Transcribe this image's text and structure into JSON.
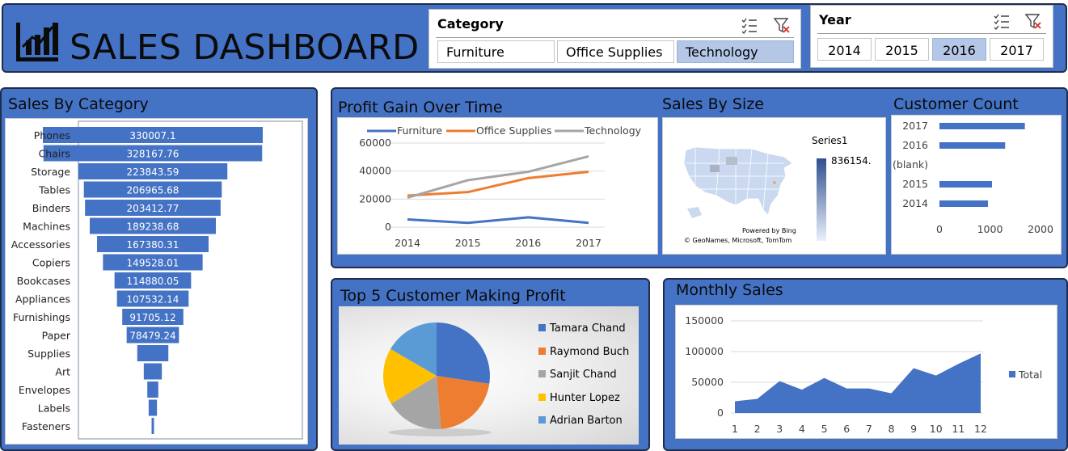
{
  "header": {
    "title": "SALES DASHBOARD"
  },
  "category_slicer": {
    "title": "Category",
    "options": [
      "Furniture",
      "Office Supplies",
      "Technology"
    ],
    "selected": "Technology"
  },
  "year_slicer": {
    "title": "Year",
    "options": [
      "2014",
      "2015",
      "2016",
      "2017"
    ],
    "selected": "2016"
  },
  "colors": {
    "panel": "#4472c4",
    "bar": "#4472c4",
    "furniture": "#4472c4",
    "office": "#ed7d31",
    "tech": "#a5a5a5",
    "selected": "#b4c7e7"
  },
  "chart_data": [
    {
      "type": "bar",
      "title": "Sales By Category",
      "categories": [
        "Phones",
        "Chairs",
        "Storage",
        "Tables",
        "Binders",
        "Machines",
        "Accessories",
        "Copiers",
        "Bookcases",
        "Appliances",
        "Furnishings",
        "Paper",
        "Supplies",
        "Art",
        "Envelopes",
        "Labels",
        "Fasteners"
      ],
      "values": [
        330007.1,
        328167.76,
        223843.59,
        206965.68,
        203412.77,
        189238.68,
        167380.31,
        149528.01,
        114880.05,
        107532.14,
        91705.12,
        78479.24,
        46673.54,
        27118.79,
        16476.4,
        12486.31,
        3024.28
      ],
      "labels": [
        "330007.1",
        "328167.76",
        "223843.59",
        "206965.68",
        "203412.77",
        "189238.68",
        "167380.31",
        "149528.01",
        "114880.05",
        "107532.14",
        "91705.12",
        "78479.24",
        "",
        "",
        "",
        "",
        ""
      ],
      "orientation": "horizontal-funnel"
    },
    {
      "type": "line",
      "title": "Profit Gain Over Time",
      "categories": [
        "2014",
        "2015",
        "2016",
        "2017"
      ],
      "series": [
        {
          "name": "Furniture",
          "values": [
            5500,
            3000,
            7000,
            3000
          ]
        },
        {
          "name": "Office Supplies",
          "values": [
            22500,
            25000,
            35000,
            39500
          ]
        },
        {
          "name": "Technology",
          "values": [
            21000,
            33500,
            39500,
            50500
          ]
        }
      ],
      "yticks": [
        "0",
        "20000",
        "40000",
        "60000"
      ],
      "ylim": [
        0,
        60000
      ],
      "legend": "top",
      "grid": true
    },
    {
      "type": "other",
      "title": "Sales By Size",
      "series_name": "Series1",
      "max_label": "836154.",
      "attribution_1": "Powered by Bing",
      "attribution_2": "© GeoNames, Microsoft, TomTom"
    },
    {
      "type": "bar",
      "title": "Customer Count",
      "categories": [
        "2017",
        "2016",
        "(blank)",
        "2015",
        "2014"
      ],
      "values": [
        1690,
        1300,
        0,
        1040,
        960
      ],
      "xticks": [
        "0",
        "1000",
        "2000"
      ],
      "xlim": [
        0,
        2000
      ],
      "orientation": "horizontal"
    },
    {
      "type": "pie",
      "title": "Top 5 Customer Making Profit",
      "labels": [
        "Tamara Chand",
        "Raymond Buch",
        "Sanjit Chand",
        "Hunter Lopez",
        "Adrian Barton"
      ],
      "values": [
        8981.32,
        6976.1,
        5757.41,
        5622.43,
        5444.81
      ],
      "legend": "right"
    },
    {
      "type": "area",
      "title": "Monthly Sales",
      "categories": [
        "1",
        "2",
        "3",
        "4",
        "5",
        "6",
        "7",
        "8",
        "9",
        "10",
        "11",
        "12"
      ],
      "series": [
        {
          "name": "Total",
          "values": [
            19000,
            23000,
            52000,
            38000,
            57000,
            40000,
            40000,
            32000,
            73000,
            61000,
            80000,
            97000
          ]
        }
      ],
      "yticks": [
        "0",
        "50000",
        "100000",
        "150000"
      ],
      "ylim": [
        0,
        150000
      ],
      "legend": "right"
    }
  ]
}
